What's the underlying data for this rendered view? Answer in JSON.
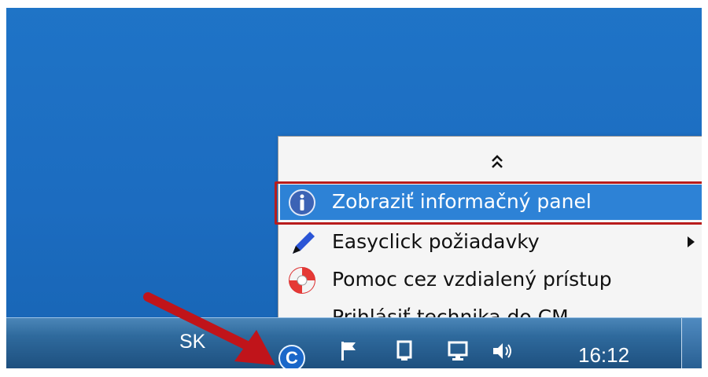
{
  "taskbar": {
    "language": "SK",
    "tray_app_letter": "C",
    "clock": "16:12"
  },
  "context_menu": {
    "items": [
      {
        "label": "Zobraziť informačný panel",
        "icon": "info-icon",
        "highlighted": true
      },
      {
        "label": "Easyclick požiadavky",
        "icon": "pencil-icon",
        "has_submenu": true
      },
      {
        "label": "Pomoc cez vzdialený prístup",
        "icon": "lifebuoy-icon"
      },
      {
        "label": "Prihlásiť technika do CM",
        "icon": ""
      }
    ]
  },
  "colors": {
    "desktop_blue": "#1f74c7",
    "highlight_blue": "#2d82d6",
    "annotation_red": "#b81c1c"
  }
}
